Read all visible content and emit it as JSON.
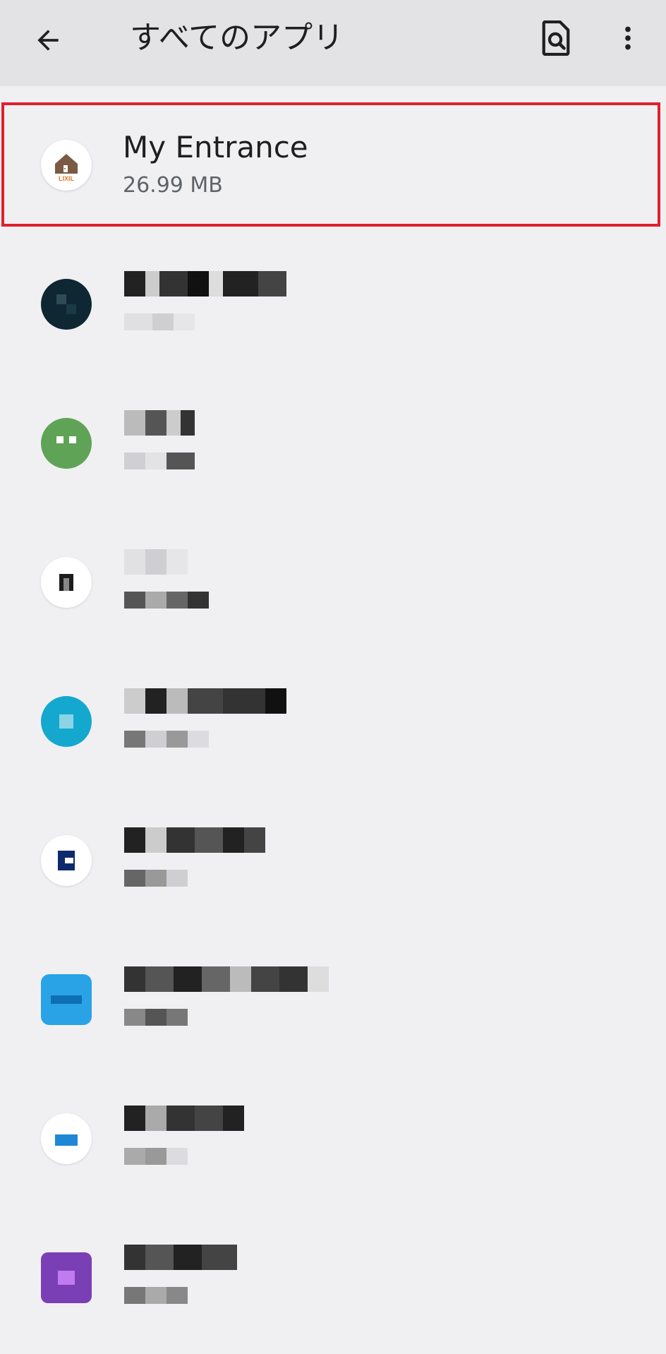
{
  "appbar": {
    "title": "すべてのアプリ",
    "back_icon": "arrow-back-icon",
    "search_icon": "document-search-icon",
    "more_icon": "more-vert-icon"
  },
  "apps": [
    {
      "name": "My Entrance",
      "size": "26.99 MB",
      "highlighted": true,
      "icon": "lixil-house-icon",
      "icon_color": "#ffffff"
    },
    {
      "name": "",
      "size": "",
      "icon": "pixelated-app-icon",
      "icon_color": "#0e2733"
    },
    {
      "name": "",
      "size": "",
      "icon": "pixelated-app-icon",
      "icon_color": "#5fa357"
    },
    {
      "name": "",
      "size": "",
      "icon": "pixelated-app-icon",
      "icon_color": "#ffffff"
    },
    {
      "name": "",
      "size": "",
      "icon": "pixelated-app-icon",
      "icon_color": "#14a8cf"
    },
    {
      "name": "",
      "size": "",
      "icon": "pixelated-app-icon",
      "icon_color": "#ffffff"
    },
    {
      "name": "",
      "size": "",
      "icon": "pixelated-app-icon",
      "icon_color": "#2aa3e6"
    },
    {
      "name": "",
      "size": "",
      "icon": "pixelated-app-icon",
      "icon_color": "#ffffff"
    },
    {
      "name": "",
      "size": "",
      "icon": "pixelated-app-icon",
      "icon_color": "#7a3fb5"
    }
  ],
  "colors": {
    "appbar_bg": "#e3e3e6",
    "page_bg": "#f0f0f3",
    "highlight_border": "#e0202a"
  }
}
